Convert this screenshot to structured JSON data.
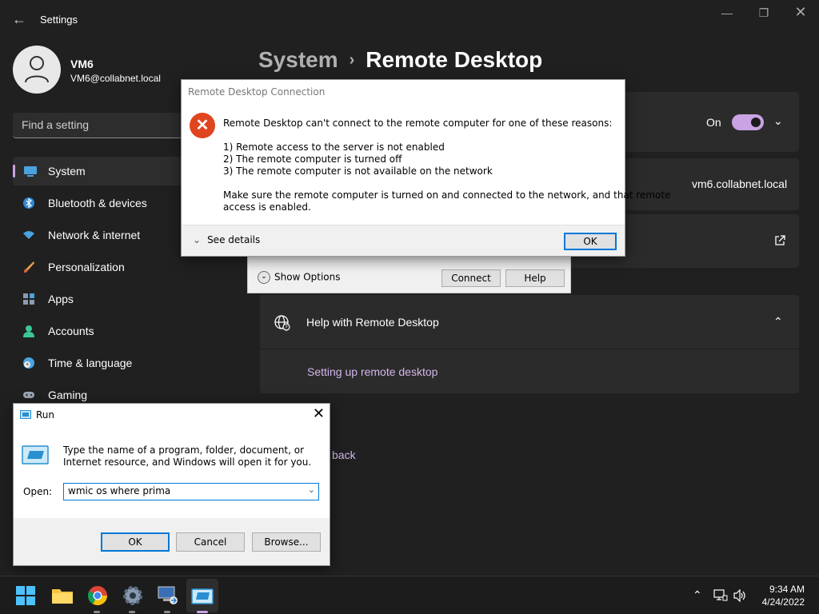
{
  "settings": {
    "app_title": "Settings",
    "user": {
      "name": "VM6",
      "email": "VM6@collabnet.local"
    },
    "search_placeholder": "Find a setting",
    "nav": [
      {
        "label": "System",
        "icon": "monitor-icon",
        "active": true
      },
      {
        "label": "Bluetooth & devices",
        "icon": "bluetooth-icon"
      },
      {
        "label": "Network & internet",
        "icon": "wifi-icon"
      },
      {
        "label": "Personalization",
        "icon": "brush-icon"
      },
      {
        "label": "Apps",
        "icon": "apps-icon"
      },
      {
        "label": "Accounts",
        "icon": "person-icon"
      },
      {
        "label": "Time & language",
        "icon": "clock-globe-icon"
      },
      {
        "label": "Gaming",
        "icon": "gamepad-icon"
      }
    ],
    "breadcrumb": {
      "parent": "System",
      "separator": "›",
      "current": "Remote Desktop"
    },
    "remote_desktop_toggle": {
      "label": "On",
      "state": true
    },
    "pc_name": "vm6.collabnet.local",
    "help": {
      "title": "Help with Remote Desktop",
      "link": "Setting up remote desktop"
    },
    "feedback_fragment": "back"
  },
  "rdc_window": {
    "show_options": "Show Options",
    "connect": "Connect",
    "help": "Help"
  },
  "error_dialog": {
    "title": "Remote Desktop Connection",
    "message": "Remote Desktop can't connect to the remote computer for one of these reasons:",
    "reasons": [
      "1) Remote access to the server is not enabled",
      "2) The remote computer is turned off",
      "3) The remote computer is not available on the network"
    ],
    "advice_line1": "Make sure the remote computer is turned on and connected to the network, and that remote",
    "advice_line2": "access is enabled.",
    "see_details": "See details",
    "ok": "OK"
  },
  "run_dialog": {
    "title": "Run",
    "description": "Type the name of a program, folder, document, or Internet resource, and Windows will open it for you.",
    "open_label": "Open:",
    "open_value": "wmic os where prima",
    "ok": "OK",
    "cancel": "Cancel",
    "browse": "Browse..."
  },
  "taskbar": {
    "time": "9:34 AM",
    "date": "4/24/2022",
    "apps": [
      "start-icon",
      "file-explorer-icon",
      "chrome-icon",
      "settings-gear-icon",
      "remote-desktop-icon",
      "run-icon"
    ]
  },
  "colors": {
    "accent": "#c9a3e4",
    "error": "#e0451f",
    "dialog_blue": "#0078d7"
  }
}
